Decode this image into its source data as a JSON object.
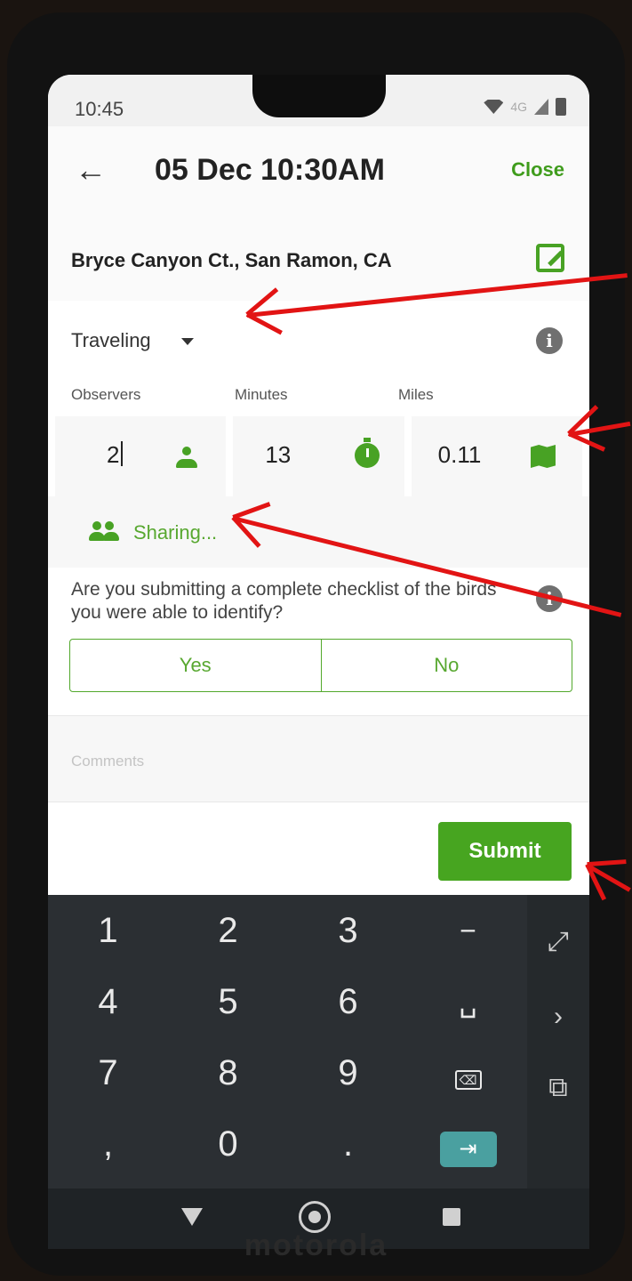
{
  "status_bar": {
    "time": "10:45",
    "network": "4G"
  },
  "header": {
    "back_icon": "arrow-left-icon",
    "title": "05 Dec 10:30AM",
    "close_label": "Close"
  },
  "location": {
    "name": "Bryce Canyon Ct., San Ramon, CA",
    "edit_icon": "edit-icon"
  },
  "protocol": {
    "selected": "Traveling"
  },
  "effort": {
    "observers": {
      "label": "Observers",
      "value": "2"
    },
    "minutes": {
      "label": "Minutes",
      "value": "13"
    },
    "miles": {
      "label": "Miles",
      "value": "0.11"
    }
  },
  "sharing": {
    "label": "Sharing..."
  },
  "complete_checklist": {
    "question": "Are you submitting a complete checklist of the birds you were able to identify?",
    "yes_label": "Yes",
    "no_label": "No"
  },
  "comments": {
    "placeholder": "Comments"
  },
  "submit_label": "Submit",
  "keyboard": {
    "rows": [
      [
        "1",
        "2",
        "3",
        "−"
      ],
      [
        "4",
        "5",
        "6",
        "␣"
      ],
      [
        "7",
        "8",
        "9",
        "⌫"
      ],
      [
        ",",
        "0",
        ".",
        "⇥"
      ]
    ],
    "side_keys": [
      "⤢",
      "›",
      "⧉"
    ]
  },
  "phone_brand": "motorola",
  "colors": {
    "accent": "#47a520",
    "annotation": "#e21414",
    "keyboard_bg": "#2b2f33"
  }
}
